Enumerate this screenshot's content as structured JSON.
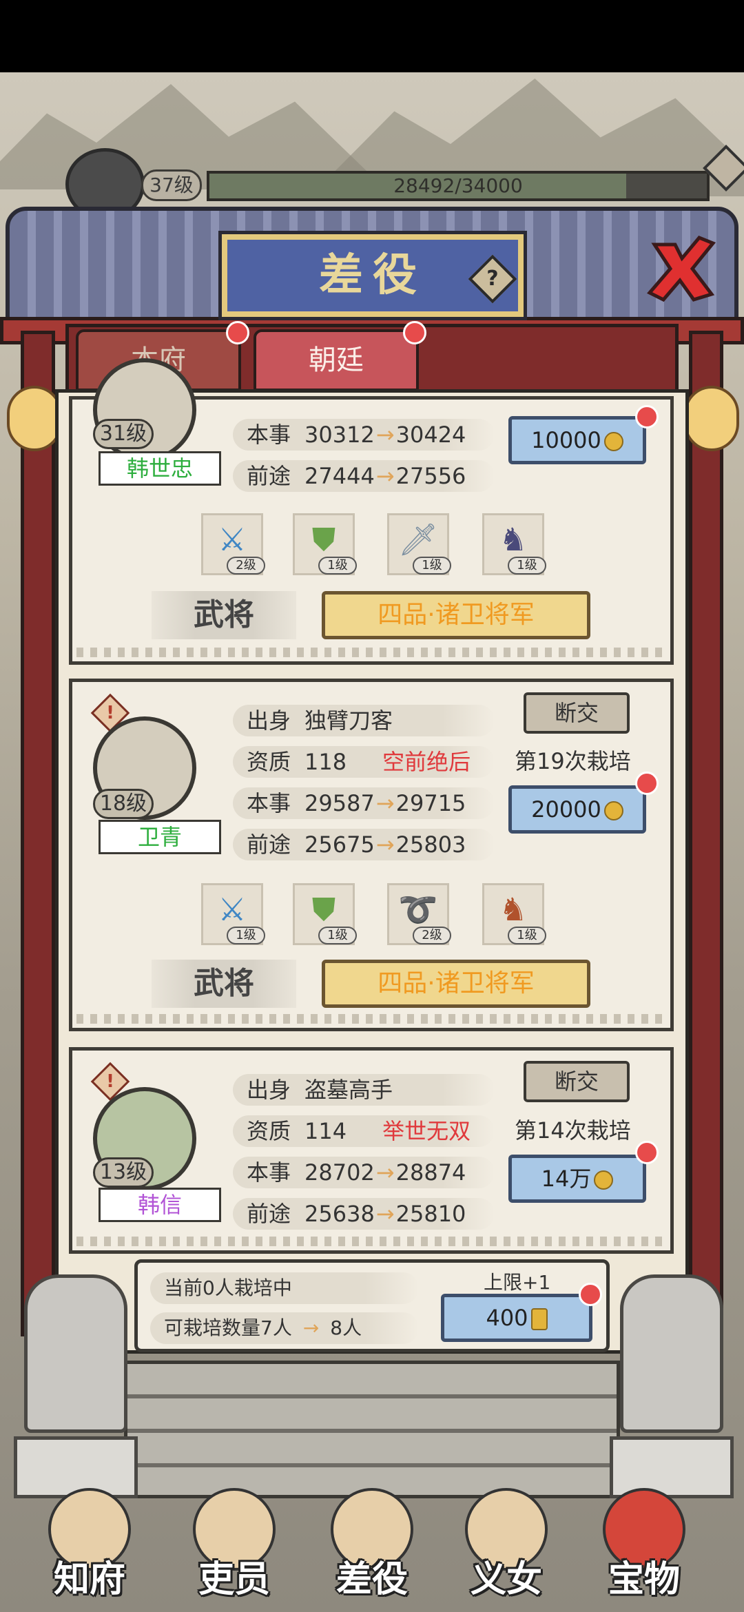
{
  "top": {
    "level": "37级",
    "exp": "28492/34000",
    "exp_fraction": 0.838
  },
  "title": "差役",
  "tabs": [
    {
      "label": "本府"
    },
    {
      "label": "朝廷"
    }
  ],
  "labels": {
    "origin": "出身",
    "aptitude": "资质",
    "skill": "本事",
    "prospect": "前途",
    "break": "断交",
    "role": "武将",
    "rank": "四品·诸卫将军"
  },
  "officers": [
    {
      "level": "31级",
      "name": "韩世忠",
      "name_color": "#2eae3e",
      "skill_from": "30312",
      "skill_to": "30424",
      "prospect_from": "27444",
      "prospect_to": "27556",
      "cost": "10000",
      "equip": [
        {
          "icon": "saber-icon",
          "level": "2级"
        },
        {
          "icon": "armor-icon",
          "level": "1级"
        },
        {
          "icon": "sword-icon",
          "level": "1级"
        },
        {
          "icon": "horse-icon",
          "level": "1级"
        }
      ]
    },
    {
      "level": "18级",
      "name": "卫青",
      "name_color": "#2eae3e",
      "origin": "独臂刀客",
      "aptitude": "118",
      "aptitude_tag": "空前绝后",
      "cultivate": "第19次栽培",
      "skill_from": "29587",
      "skill_to": "29715",
      "prospect_from": "25675",
      "prospect_to": "25803",
      "cost": "20000",
      "equip": [
        {
          "icon": "saber-icon",
          "level": "1级"
        },
        {
          "icon": "armor-icon",
          "level": "1级"
        },
        {
          "icon": "whip-icon",
          "level": "2级"
        },
        {
          "icon": "horse-icon",
          "level": "1级"
        }
      ]
    },
    {
      "level": "13级",
      "name": "韩信",
      "name_color": "#b254d6",
      "origin": "盗墓高手",
      "aptitude": "114",
      "aptitude_tag": "举世无双",
      "cultivate": "第14次栽培",
      "skill_from": "28702",
      "skill_to": "28874",
      "prospect_from": "25638",
      "prospect_to": "25810",
      "cost": "14万"
    }
  ],
  "summary": {
    "current": "当前0人栽培中",
    "capacity": "可栽培数量7人",
    "capacity_next": "8人",
    "limit": "上限+1",
    "cost": "400"
  },
  "nav": [
    {
      "label": "知府"
    },
    {
      "label": "吏员"
    },
    {
      "label": "差役"
    },
    {
      "label": "义女"
    },
    {
      "label": "宝物"
    }
  ],
  "colors": {
    "aptitude_tag": "#e0393c",
    "rank_text": "#f09a21"
  }
}
